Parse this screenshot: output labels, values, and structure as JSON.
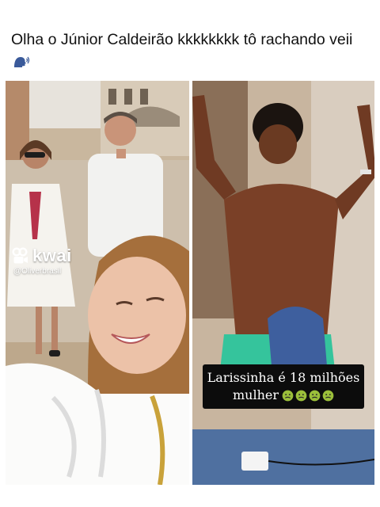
{
  "post": {
    "caption": "Olha o Júnior Caldeirão kkkkkkkk tô rachando veii",
    "caption_emoji_icon": "speaking-head-icon"
  },
  "video_left": {
    "watermark_brand": "kwai",
    "watermark_handle": "@Oliverbrasil"
  },
  "video_right": {
    "subtitle_line1": "Larissinha é 18 milhões",
    "subtitle_line2": "mulher",
    "subtitle_emoji_icon": "nauseated-face-icon",
    "subtitle_emoji_count": 4
  }
}
